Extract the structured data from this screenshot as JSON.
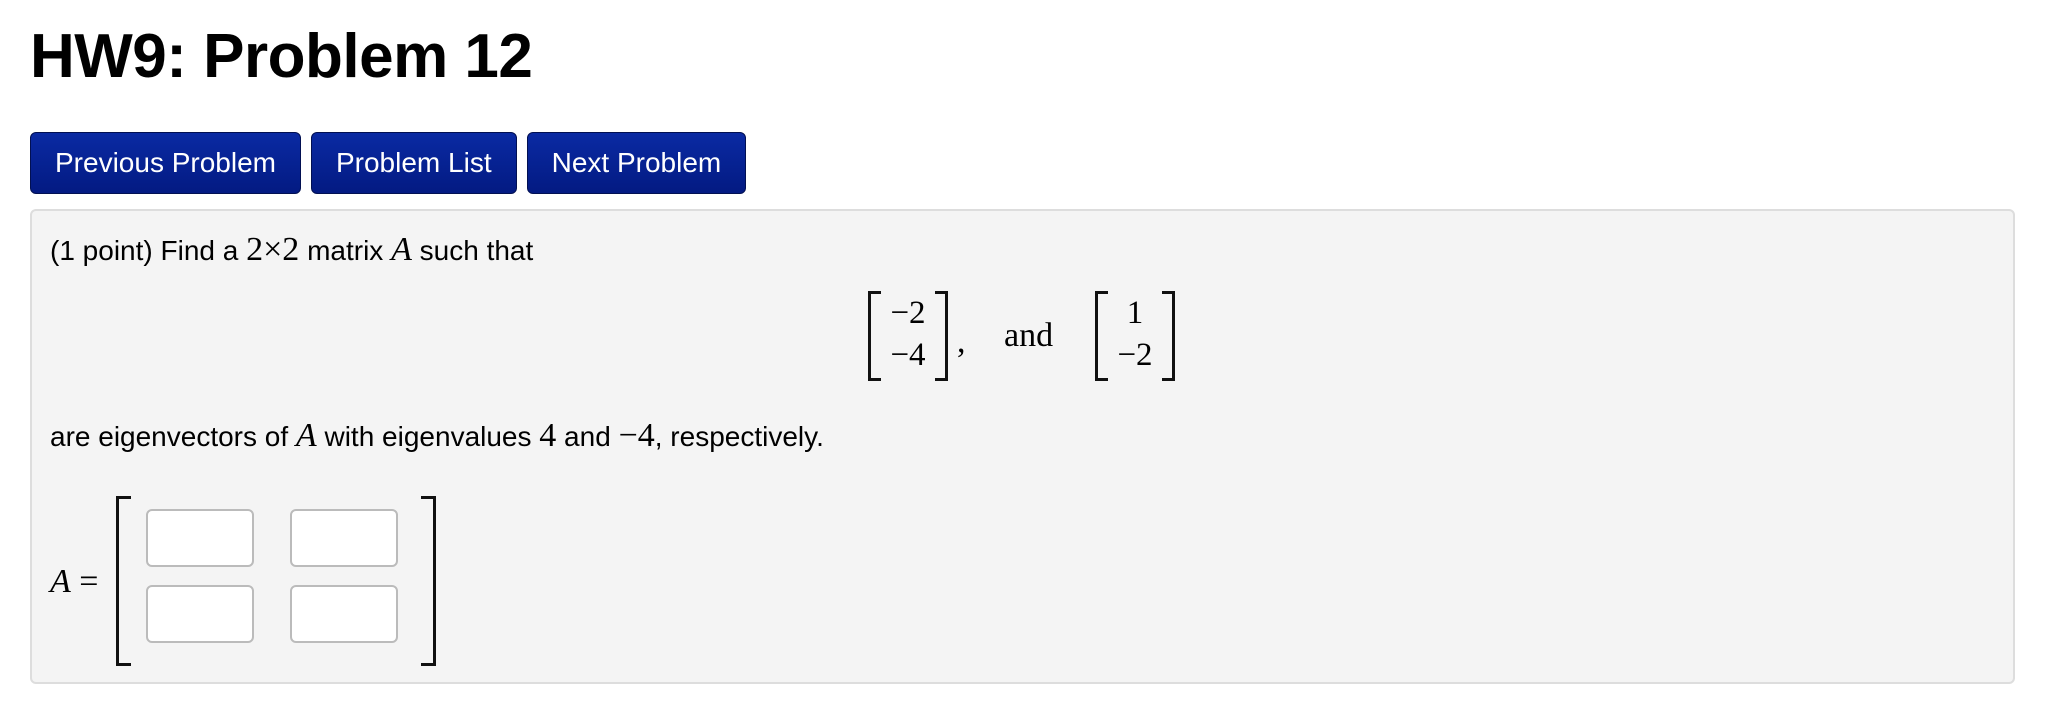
{
  "page": {
    "title": "HW9: Problem 12"
  },
  "nav": {
    "previous_label": "Previous Problem",
    "list_label": "Problem List",
    "next_label": "Next Problem",
    "button_color": "#031a82"
  },
  "problem": {
    "intro_prefix": "(1 point) Find a ",
    "dim_rows": "2",
    "times": "×",
    "dim_cols": "2",
    "intro_mid": " matrix ",
    "matrix_symbol": "A",
    "intro_suffix": " such that",
    "vector1": [
      "−2",
      "−4"
    ],
    "comma": ",",
    "and_word": "and",
    "vector2": [
      "1",
      "−2"
    ],
    "eigen_prefix": "are eigenvectors of ",
    "eigen_mid": " with eigenvalues ",
    "eigenvalue1": "4",
    "eigen_and": " and ",
    "eigenvalue2": "−4",
    "eigen_suffix": ", respectively."
  },
  "answer": {
    "label": "A",
    "equals": " =",
    "cells": [
      {
        "value": "",
        "placeholder": ""
      },
      {
        "value": "",
        "placeholder": ""
      },
      {
        "value": "",
        "placeholder": ""
      },
      {
        "value": "",
        "placeholder": ""
      }
    ]
  }
}
